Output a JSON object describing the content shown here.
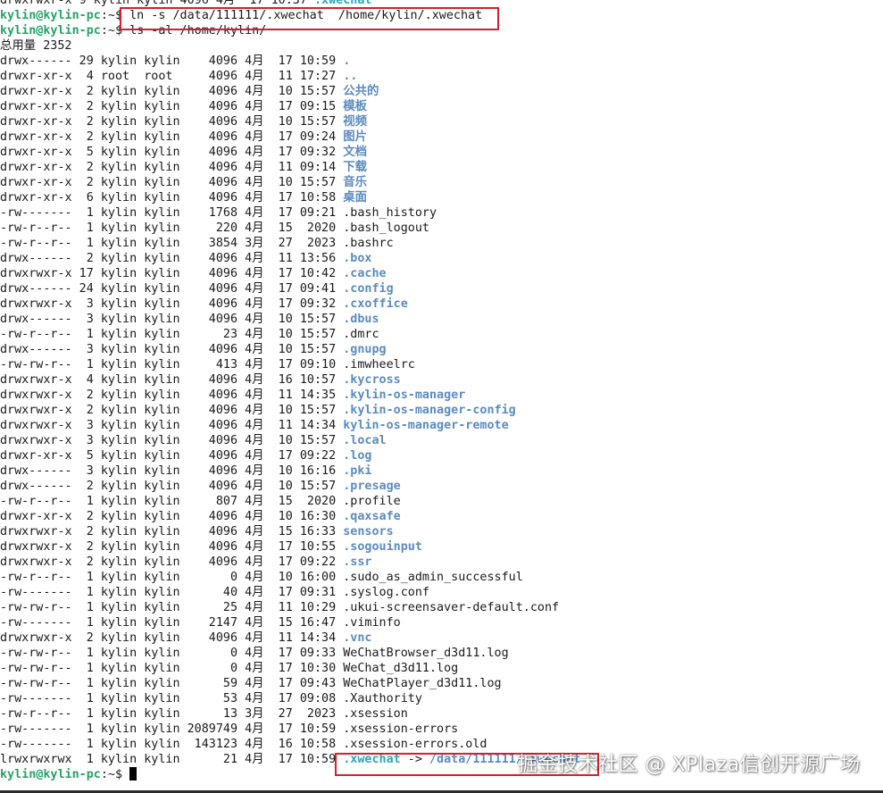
{
  "top_partial": {
    "text": "drwxrwxr-x 9 kylin kylin 4096 4月  17 10:37 ",
    "name": ".xwechat"
  },
  "commands": [
    {
      "prompt": "kylin@kylin-pc",
      "symbol": ":~$ ",
      "command": "ln -s /data/111111/.xwechat  /home/kylin/.xwechat"
    },
    {
      "prompt": "kylin@kylin-pc",
      "symbol": ":~$ ",
      "command": "ls -al /home/kylin/"
    }
  ],
  "total_line": "总用量 2352",
  "entries": [
    {
      "meta": "drwx------ 29 kylin kylin    4096 4月  17 10:59 ",
      "name": ".",
      "type": "dir"
    },
    {
      "meta": "drwxr-xr-x  4 root  root     4096 4月  11 17:27 ",
      "name": "..",
      "type": "dir"
    },
    {
      "meta": "drwxr-xr-x  2 kylin kylin    4096 4月  10 15:57 ",
      "name": "公共的",
      "type": "dir"
    },
    {
      "meta": "drwxr-xr-x  2 kylin kylin    4096 4月  17 09:15 ",
      "name": "模板",
      "type": "dir"
    },
    {
      "meta": "drwxr-xr-x  2 kylin kylin    4096 4月  10 15:57 ",
      "name": "视频",
      "type": "dir"
    },
    {
      "meta": "drwxr-xr-x  2 kylin kylin    4096 4月  17 09:24 ",
      "name": "图片",
      "type": "dir"
    },
    {
      "meta": "drwxr-xr-x  5 kylin kylin    4096 4月  17 09:32 ",
      "name": "文档",
      "type": "dir"
    },
    {
      "meta": "drwxr-xr-x  2 kylin kylin    4096 4月  11 09:14 ",
      "name": "下载",
      "type": "dir"
    },
    {
      "meta": "drwxr-xr-x  2 kylin kylin    4096 4月  10 15:57 ",
      "name": "音乐",
      "type": "dir"
    },
    {
      "meta": "drwxr-xr-x  6 kylin kylin    4096 4月  17 10:58 ",
      "name": "桌面",
      "type": "dir"
    },
    {
      "meta": "-rw-------  1 kylin kylin    1768 4月  17 09:21 ",
      "name": ".bash_history",
      "type": "file"
    },
    {
      "meta": "-rw-r--r--  1 kylin kylin     220 4月  15  2020 ",
      "name": ".bash_logout",
      "type": "file"
    },
    {
      "meta": "-rw-r--r--  1 kylin kylin    3854 3月  27  2023 ",
      "name": ".bashrc",
      "type": "file"
    },
    {
      "meta": "drwx------  2 kylin kylin    4096 4月  11 13:56 ",
      "name": ".box",
      "type": "dir"
    },
    {
      "meta": "drwxrwxr-x 17 kylin kylin    4096 4月  17 10:42 ",
      "name": ".cache",
      "type": "dir"
    },
    {
      "meta": "drwx------ 24 kylin kylin    4096 4月  17 09:41 ",
      "name": ".config",
      "type": "dir"
    },
    {
      "meta": "drwxrwxr-x  3 kylin kylin    4096 4月  17 09:32 ",
      "name": ".cxoffice",
      "type": "dir"
    },
    {
      "meta": "drwx------  3 kylin kylin    4096 4月  10 15:57 ",
      "name": ".dbus",
      "type": "dir"
    },
    {
      "meta": "-rw-r--r--  1 kylin kylin      23 4月  10 15:57 ",
      "name": ".dmrc",
      "type": "file"
    },
    {
      "meta": "drwx------  3 kylin kylin    4096 4月  10 15:57 ",
      "name": ".gnupg",
      "type": "dir"
    },
    {
      "meta": "-rw-rw-r--  1 kylin kylin     413 4月  17 09:10 ",
      "name": ".imwheelrc",
      "type": "file"
    },
    {
      "meta": "drwxrwxr-x  4 kylin kylin    4096 4月  16 10:57 ",
      "name": ".kycross",
      "type": "dir"
    },
    {
      "meta": "drwxrwxr-x  2 kylin kylin    4096 4月  11 14:35 ",
      "name": ".kylin-os-manager",
      "type": "dir"
    },
    {
      "meta": "drwxrwxr-x  2 kylin kylin    4096 4月  10 15:57 ",
      "name": ".kylin-os-manager-config",
      "type": "dir"
    },
    {
      "meta": "drwxrwxr-x  3 kylin kylin    4096 4月  11 14:34 ",
      "name": "kylin-os-manager-remote",
      "type": "dir"
    },
    {
      "meta": "drwxrwxr-x  3 kylin kylin    4096 4月  10 15:57 ",
      "name": ".local",
      "type": "dir"
    },
    {
      "meta": "drwxr-xr-x  5 kylin kylin    4096 4月  17 09:22 ",
      "name": ".log",
      "type": "dir"
    },
    {
      "meta": "drwx------  3 kylin kylin    4096 4月  10 16:16 ",
      "name": ".pki",
      "type": "dir"
    },
    {
      "meta": "drwx------  2 kylin kylin    4096 4月  10 15:57 ",
      "name": ".presage",
      "type": "dir"
    },
    {
      "meta": "-rw-r--r--  1 kylin kylin     807 4月  15  2020 ",
      "name": ".profile",
      "type": "file"
    },
    {
      "meta": "drwxr-xr-x  2 kylin kylin    4096 4月  10 16:30 ",
      "name": ".qaxsafe",
      "type": "dir"
    },
    {
      "meta": "drwxrwxr-x  2 kylin kylin    4096 4月  15 16:33 ",
      "name": "sensors",
      "type": "dir"
    },
    {
      "meta": "drwxrwxr-x  2 kylin kylin    4096 4月  17 10:55 ",
      "name": ".sogouinput",
      "type": "dir"
    },
    {
      "meta": "drwxrwxr-x  2 kylin kylin    4096 4月  17 09:22 ",
      "name": ".ssr",
      "type": "dir"
    },
    {
      "meta": "-rw-r--r--  1 kylin kylin       0 4月  10 16:00 ",
      "name": ".sudo_as_admin_successful",
      "type": "file"
    },
    {
      "meta": "-rw-------  1 kylin kylin      40 4月  17 09:31 ",
      "name": ".syslog.conf",
      "type": "file"
    },
    {
      "meta": "-rw-rw-r--  1 kylin kylin      25 4月  11 10:29 ",
      "name": ".ukui-screensaver-default.conf",
      "type": "file"
    },
    {
      "meta": "-rw-------  1 kylin kylin    2147 4月  15 16:47 ",
      "name": ".viminfo",
      "type": "file"
    },
    {
      "meta": "drwxrwxr-x  2 kylin kylin    4096 4月  11 14:34 ",
      "name": ".vnc",
      "type": "dir"
    },
    {
      "meta": "-rw-rw-r--  1 kylin kylin       0 4月  17 09:33 ",
      "name": "WeChatBrowser_d3d11.log",
      "type": "file"
    },
    {
      "meta": "-rw-rw-r--  1 kylin kylin       0 4月  17 10:30 ",
      "name": "WeChat_d3d11.log",
      "type": "file"
    },
    {
      "meta": "-rw-rw-r--  1 kylin kylin      59 4月  17 09:43 ",
      "name": "WeChatPlayer_d3d11.log",
      "type": "file"
    },
    {
      "meta": "-rw-------  1 kylin kylin      53 4月  17 09:08 ",
      "name": ".Xauthority",
      "type": "file"
    },
    {
      "meta": "-rw-r--r--  1 kylin kylin      13 3月  27  2023 ",
      "name": ".xsession",
      "type": "file"
    },
    {
      "meta": "-rw-------  1 kylin kylin 2089749 4月  17 10:59 ",
      "name": ".xsession-errors",
      "type": "file"
    },
    {
      "meta": "-rw-------  1 kylin kylin  143123 4月  16 10:58 ",
      "name": ".xsession-errors.old",
      "type": "file"
    }
  ],
  "symlink_entry": {
    "meta": "lrwxrwxrwx  1 kylin kylin      21 4月  17 10:59 ",
    "name": ".xwechat",
    "arrow": " -> ",
    "target": "/data/111111/.xwechat"
  },
  "final_prompt": {
    "prompt": "kylin@kylin-pc",
    "symbol": ":~$ "
  },
  "watermark": "掘金技术社区 @ XPlaza信创开源广场",
  "colors": {
    "prompt": "#26a269",
    "directory": "#5b8bc0",
    "symlink": "#2aa6b9",
    "highlight_box": "#d4202a"
  }
}
